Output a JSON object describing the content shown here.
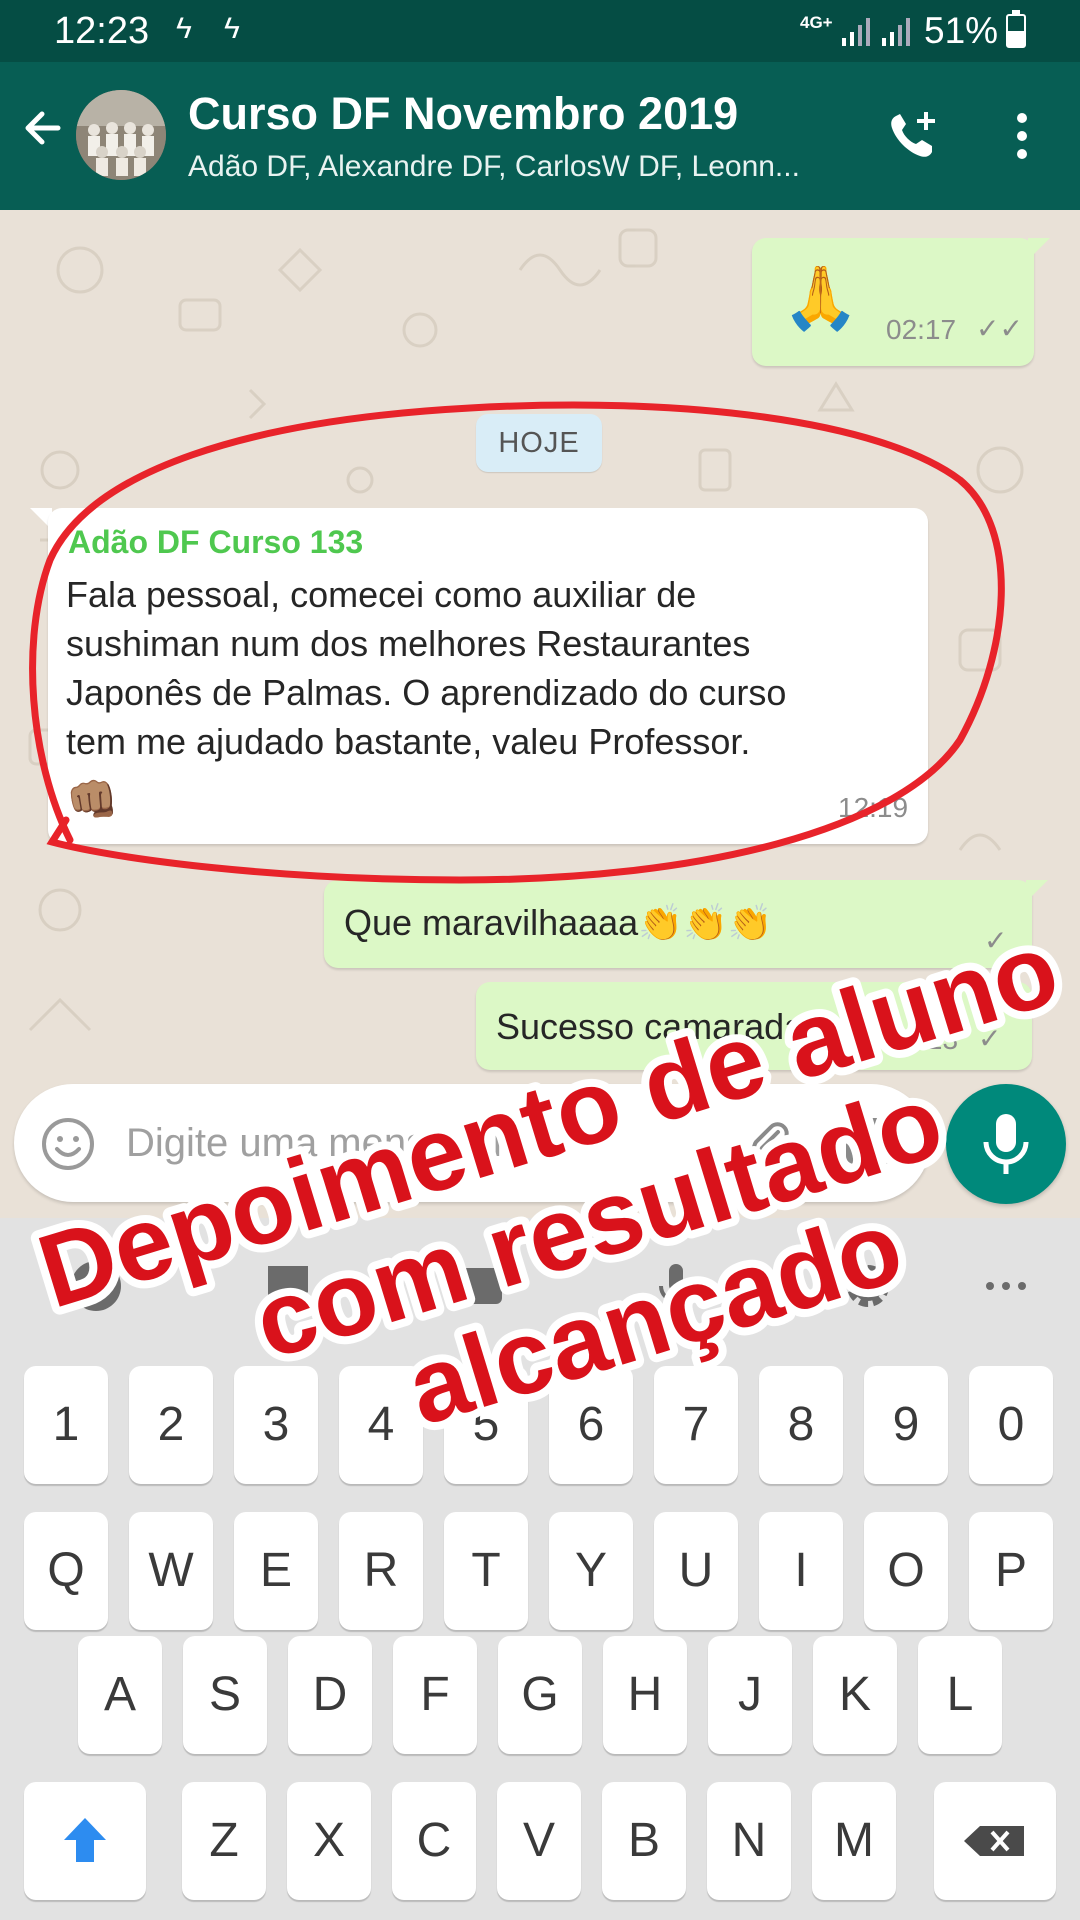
{
  "status_bar": {
    "time": "12:23",
    "network": "4G+",
    "battery_percent": "51%",
    "battery_level": 0.51
  },
  "header": {
    "title": "Curso DF Novembro 2019",
    "members": "Adão DF, Alexandre DF, CarlosW DF, Leonn..."
  },
  "messages": [
    {
      "direction": "out",
      "emoji": "🙏",
      "time": "02:17",
      "status": "read"
    },
    {
      "date_chip": "HOJE"
    },
    {
      "direction": "in",
      "sender": "Adão DF Curso 133",
      "lines": [
        "Fala pessoal, comecei como auxiliar de",
        "sushiman num dos melhores Restaurantes",
        "Japonês de Palmas. O aprendizado do curso",
        "tem me ajudado bastante, valeu Professor."
      ],
      "emoji": "👊🏽",
      "time": "12:19"
    },
    {
      "direction": "out",
      "text": "Que maravilhaaaa👏👏👏",
      "status": "read"
    },
    {
      "direction": "out",
      "text": "Sucesso camarada!",
      "time": "12:23",
      "status": "sent"
    }
  ],
  "composer": {
    "placeholder": "Digite uma mensagem"
  },
  "keyboard": {
    "number_row": [
      "1",
      "2",
      "3",
      "4",
      "5",
      "6",
      "7",
      "8",
      "9",
      "0"
    ],
    "row1": [
      "Q",
      "W",
      "E",
      "R",
      "T",
      "Y",
      "U",
      "I",
      "O",
      "P"
    ],
    "row2": [
      "A",
      "S",
      "D",
      "F",
      "G",
      "H",
      "J",
      "K",
      "L"
    ],
    "row3": [
      "Z",
      "X",
      "C",
      "V",
      "B",
      "N",
      "M"
    ],
    "tools": [
      "emoji-icon",
      "sticker-icon",
      "gif-icon",
      "voice-input-icon",
      "settings-icon",
      "more-icon"
    ]
  },
  "overlay": {
    "lines": [
      "Depoimento de aluno",
      "com resultado",
      "alcançado"
    ],
    "text_color": "#d9121b",
    "outline_color": "#ffffff",
    "circle_color": "#e8232a"
  },
  "colors": {
    "header": "#075e54",
    "status_bar": "#054d44",
    "outgoing_bubble": "#dcf8c6",
    "incoming_bubble": "#ffffff",
    "sender_name": "#4fc84f",
    "mic_button": "#00897b"
  }
}
